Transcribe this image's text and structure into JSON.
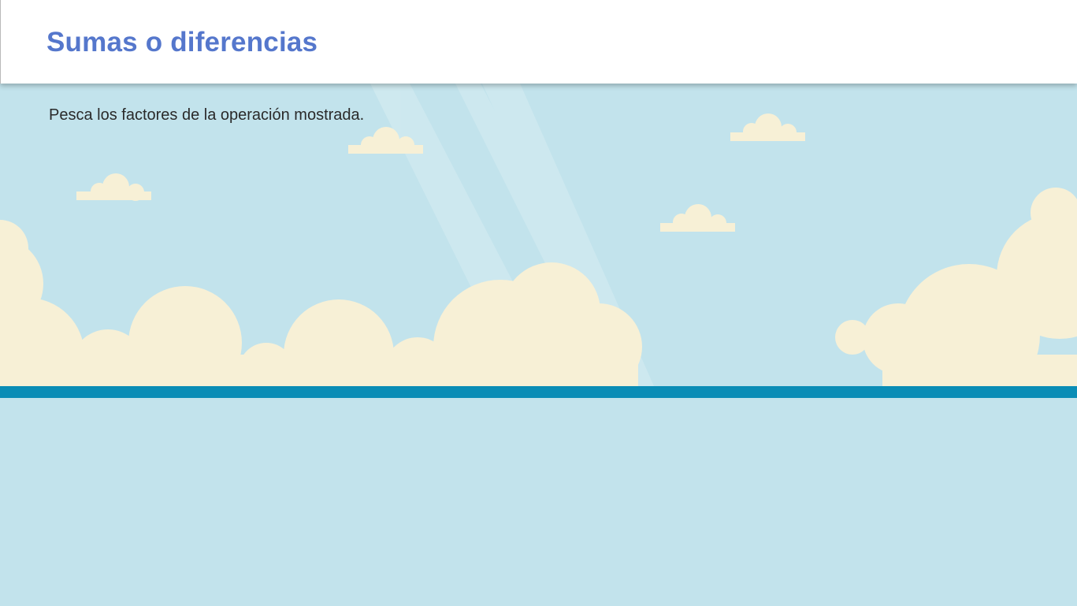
{
  "header": {
    "title": "Sumas o diferencias"
  },
  "main": {
    "instructions": "Pesca los factores de la operación mostrada."
  },
  "colors": {
    "sky": "#c2e3ec",
    "cloud": "#f7f0d6",
    "water_line": "#0a8db6",
    "title": "#5577cc",
    "header_bg": "#ffffff"
  }
}
